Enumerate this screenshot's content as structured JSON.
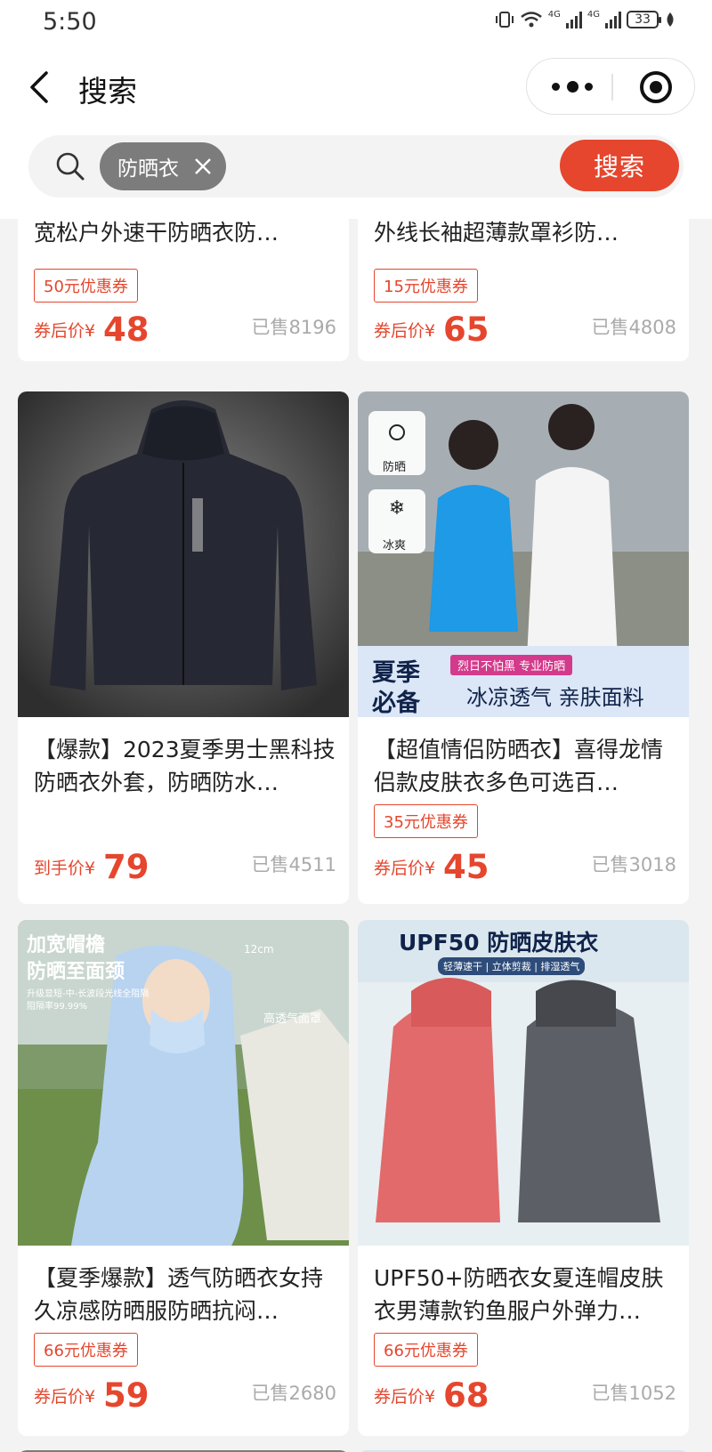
{
  "status_bar": {
    "time": "5:50",
    "battery": "33",
    "network_1": "4G",
    "network_2": "4G"
  },
  "nav": {
    "title": "搜索"
  },
  "search": {
    "chip_label": "防晒衣",
    "button_label": "搜索"
  },
  "colors": {
    "accent": "#e5462d",
    "chip": "#7c7c7c",
    "background": "#f3f3f3"
  },
  "products": [
    {
      "title": "男士夏季防晒服冰丝网眼透气宽松户外速干防晒衣防…",
      "coupon": "50元优惠券",
      "price_label": "券后价¥",
      "price": "48",
      "sold": "已售8196"
    },
    {
      "title": "冰丝防晒衣男女同款夏季防紫外线长袖超薄款罩衫防…",
      "coupon": "15元优惠券",
      "price_label": "券后价¥",
      "price": "65",
      "sold": "已售4808"
    },
    {
      "title": "【爆款】2023夏季男士黑科技防晒衣外套，防晒防水…",
      "coupon": "",
      "price_label": "到手价¥",
      "price": "79",
      "sold": "已售4511"
    },
    {
      "title": "【超值情侣防晒衣】喜得龙情侣款皮肤衣多色可选百…",
      "coupon": "35元优惠券",
      "price_label": "券后价¥",
      "price": "45",
      "sold": "已售3018"
    },
    {
      "title": "【夏季爆款】透气防晒衣女持久凉感防晒服防晒抗闷…",
      "coupon": "66元优惠券",
      "price_label": "券后价¥",
      "price": "59",
      "sold": "已售2680"
    },
    {
      "title": "UPF50+防晒衣女夏连帽皮肤衣男薄款钓鱼服户外弹力…",
      "coupon": "66元优惠券",
      "price_label": "券后价¥",
      "price": "68",
      "sold": "已售1052"
    }
  ],
  "image_texts": {
    "p4_badge_1": "防晒",
    "p4_badge_2": "冰爽",
    "p4_season": "夏季",
    "p4_season2": "必备",
    "p4_tag": "烈日不怕黑 专业防晒",
    "p4_banner": "冰凉透气 亲肤面料",
    "p5_head1": "加宽帽檐",
    "p5_head2": "防晒至面颈",
    "p5_sub1": "升级显短-中-长波段光线全阻隔",
    "p5_sub2": "阻隔率99.99%",
    "p5_size": "12cm",
    "p5_mask": "高透气面罩",
    "p6_head": "UPF50 防晒皮肤衣",
    "p6_tags": "轻薄速干 | 立体剪裁 | 排湿透气"
  }
}
